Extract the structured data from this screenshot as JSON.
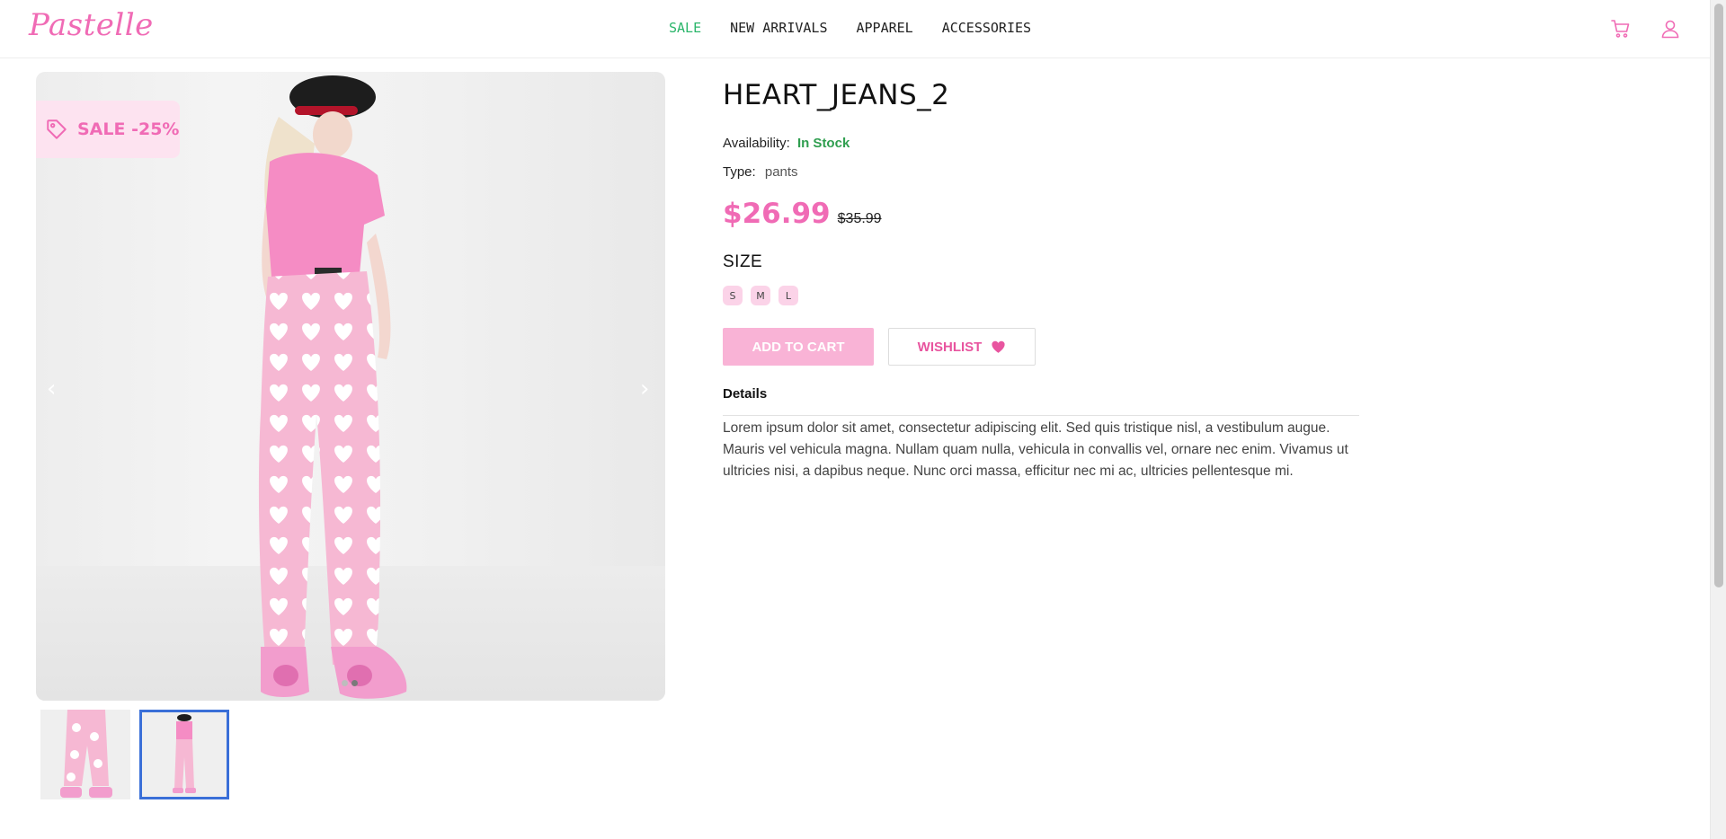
{
  "brand": {
    "logo_text": "Pastelle",
    "accent_color": "#f06bb5",
    "sale_color": "#2ab56a"
  },
  "nav": {
    "items": [
      "SALE",
      "NEW ARRIVALS",
      "APPAREL",
      "ACCESSORIES"
    ]
  },
  "header_icons": [
    "cart-icon",
    "user-icon"
  ],
  "gallery": {
    "badge_text": "SALE -25%",
    "badge_icon": "tag-icon",
    "prev_arrow": "‹",
    "next_arrow": "›",
    "slide_count": 2,
    "active_slide": 2
  },
  "product": {
    "title": "HEART_JEANS_2",
    "availability_label": "Availability:",
    "availability_value": "In Stock",
    "type_label": "Type:",
    "type_value": "pants",
    "price": "$26.99",
    "old_price": "$35.99",
    "size_heading": "SIZE",
    "sizes": [
      "S",
      "M",
      "L"
    ],
    "add_to_cart_label": "ADD TO CART",
    "wishlist_label": "WISHLIST",
    "details_heading": "Details",
    "details_text": "Lorem ipsum dolor sit amet, consectetur adipiscing elit. Sed quis tristique nisl, a vestibulum augue. Mauris vel vehicula magna. Nullam quam nulla, vehicula in convallis vel, ornare nec enim. Vivamus ut ultricies nisi, a dapibus neque. Nunc orci massa, efficitur nec mi ac, ultricies pellentesque mi."
  }
}
